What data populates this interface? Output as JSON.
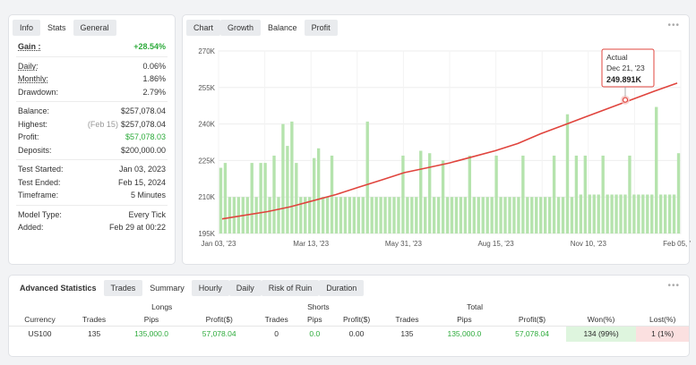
{
  "left_panel": {
    "tabs": [
      "Info",
      "Stats",
      "General"
    ],
    "gain": {
      "label": "Gain :",
      "value": "+28.54%"
    },
    "rows1": [
      {
        "label": "Daily:",
        "value": "0.06%"
      },
      {
        "label": "Monthly:",
        "value": "1.86%"
      },
      {
        "label": "Drawdown:",
        "value": "2.79%"
      }
    ],
    "balance": {
      "label": "Balance:",
      "value": "$257,078.04"
    },
    "highest": {
      "label": "Highest:",
      "note": "(Feb 15)",
      "value": "$257,078.04"
    },
    "profit": {
      "label": "Profit:",
      "value": "$57,078.03"
    },
    "deposits": {
      "label": "Deposits:",
      "value": "$200,000.00"
    },
    "rows3": [
      {
        "label": "Test Started:",
        "value": "Jan 03, 2023"
      },
      {
        "label": "Test Ended:",
        "value": "Feb 15, 2024"
      },
      {
        "label": "Timeframe:",
        "value": "5 Minutes"
      }
    ],
    "rows4": [
      {
        "label": "Model Type:",
        "value": "Every Tick"
      },
      {
        "label": "Added:",
        "value": "Feb 29 at 00:22"
      }
    ]
  },
  "chart_panel": {
    "tabs": [
      "Chart",
      "Growth",
      "Balance",
      "Profit"
    ],
    "more": "•••",
    "tooltip": {
      "title": "Actual",
      "date": "Dec 21, '23",
      "value": "249.891K"
    }
  },
  "bottom_panel": {
    "tabs": [
      "Advanced Statistics",
      "Trades",
      "Summary",
      "Hourly",
      "Daily",
      "Risk of Ruin",
      "Duration"
    ],
    "more": "•••",
    "groups": {
      "longs": "Longs",
      "shorts": "Shorts",
      "total": "Total"
    },
    "headers": [
      "Currency",
      "Trades",
      "Pips",
      "Profit($)",
      "Trades",
      "Pips",
      "Profit($)",
      "Trades",
      "Pips",
      "Profit($)",
      "Won(%)",
      "Lost(%)"
    ],
    "row": [
      "US100",
      "135",
      "135,000.0",
      "57,078.04",
      "0",
      "0.0",
      "0.00",
      "135",
      "135,000.0",
      "57,078.04",
      "134 (99%)",
      "1 (1%)"
    ]
  },
  "colors": {
    "line": "#e0443d",
    "bars": "#b5e3ad",
    "green": "#2eab3c",
    "tooltip_border": "#e0443d"
  },
  "chart_data": {
    "type": "line",
    "title": "",
    "yticks": [
      "270K",
      "255K",
      "240K",
      "225K",
      "210K",
      "195K"
    ],
    "xticks": [
      "Jan 03, '23",
      "Mar 13, '23",
      "May 31, '23",
      "Aug 15, '23",
      "Nov 10, '23",
      "Feb 05, '24"
    ],
    "ylim": [
      195000,
      270000
    ],
    "series": [
      {
        "type": "line",
        "x": [
          0,
          0.05,
          0.1,
          0.15,
          0.2,
          0.25,
          0.3,
          0.35,
          0.4,
          0.45,
          0.5,
          0.55,
          0.6,
          0.65,
          0.7,
          0.75,
          0.8,
          0.85,
          0.9,
          0.95,
          1.0
        ],
        "values": [
          201000,
          202500,
          204000,
          206000,
          208500,
          211000,
          214000,
          217000,
          220000,
          222000,
          224000,
          226500,
          229000,
          232000,
          236000,
          239500,
          243000,
          246500,
          250000,
          253500,
          256800
        ]
      },
      {
        "type": "bar",
        "values": [
          222,
          224,
          210,
          210,
          210,
          210,
          210,
          224,
          210,
          224,
          224,
          210,
          227,
          210,
          240,
          231,
          241,
          224,
          210,
          210,
          210,
          226,
          230,
          210,
          210,
          227,
          210,
          210,
          210,
          210,
          210,
          210,
          210,
          241,
          210,
          210,
          210,
          210,
          210,
          210,
          210,
          227,
          210,
          210,
          210,
          229,
          210,
          228,
          210,
          210,
          225,
          210,
          210,
          210,
          210,
          210,
          227,
          210,
          210,
          210,
          210,
          210,
          227,
          210,
          210,
          210,
          210,
          210,
          227,
          210,
          210,
          210,
          210,
          210,
          210,
          227,
          210,
          210,
          244,
          210,
          227,
          211,
          227,
          211,
          211,
          211,
          227,
          211,
          211,
          211,
          211,
          211,
          227,
          211,
          211,
          211,
          211,
          211,
          247,
          211,
          211,
          211,
          211,
          228
        ]
      }
    ]
  }
}
